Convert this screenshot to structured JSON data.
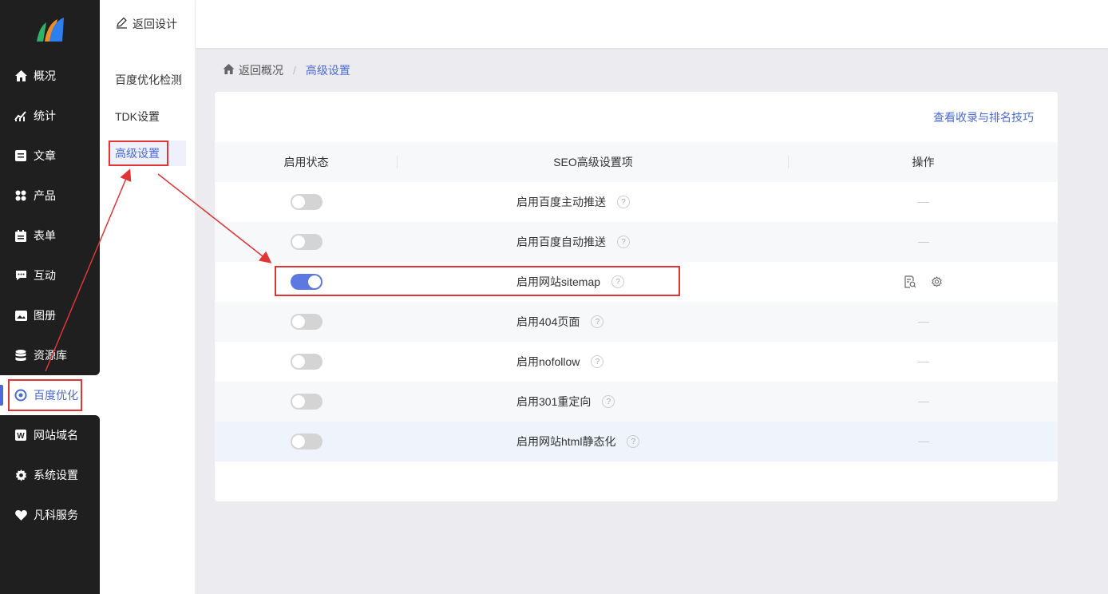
{
  "app": {
    "accent": "#4a6ad6",
    "sidebar_bg": "#1f1f1f",
    "annotation_color": "#e03535"
  },
  "sidebar": {
    "items": [
      {
        "label": "概况",
        "icon": "home-icon"
      },
      {
        "label": "统计",
        "icon": "chart-icon"
      },
      {
        "label": "文章",
        "icon": "article-icon"
      },
      {
        "label": "产品",
        "icon": "grid-icon"
      },
      {
        "label": "表单",
        "icon": "calendar-icon"
      },
      {
        "label": "互动",
        "icon": "chat-icon"
      },
      {
        "label": "图册",
        "icon": "image-icon"
      },
      {
        "label": "资源库",
        "icon": "database-icon"
      },
      {
        "label": "百度优化",
        "icon": "target-icon",
        "active": true
      },
      {
        "label": "网站域名",
        "icon": "w-icon"
      },
      {
        "label": "系统设置",
        "icon": "gear-icon"
      },
      {
        "label": "凡科服务",
        "icon": "heart-icon"
      }
    ]
  },
  "subnav": {
    "back_label": "返回设计",
    "items": [
      {
        "label": "百度优化检测"
      },
      {
        "label": "TDK设置"
      },
      {
        "label": "高级设置",
        "active": true
      }
    ]
  },
  "breadcrumb": {
    "home_label": "返回概况",
    "separator": "/",
    "current": "高级设置"
  },
  "card": {
    "tips_link": "查看收录与排名技巧",
    "columns": [
      "启用状态",
      "SEO高级设置项",
      "操作"
    ],
    "rows": [
      {
        "label": "启用百度主动推送",
        "enabled": false,
        "action": "—"
      },
      {
        "label": "启用百度自动推送",
        "enabled": false,
        "action": "—"
      },
      {
        "label": "启用网站sitemap",
        "enabled": true,
        "action_icons": [
          "view-doc-icon",
          "settings-icon"
        ]
      },
      {
        "label": "启用404页面",
        "enabled": false,
        "action": "—"
      },
      {
        "label": "启用nofollow",
        "enabled": false,
        "action": "—"
      },
      {
        "label": "启用301重定向",
        "enabled": false,
        "action": "—"
      },
      {
        "label": "启用网站html静态化",
        "enabled": false,
        "action": "—"
      }
    ],
    "help_glyph": "?"
  }
}
